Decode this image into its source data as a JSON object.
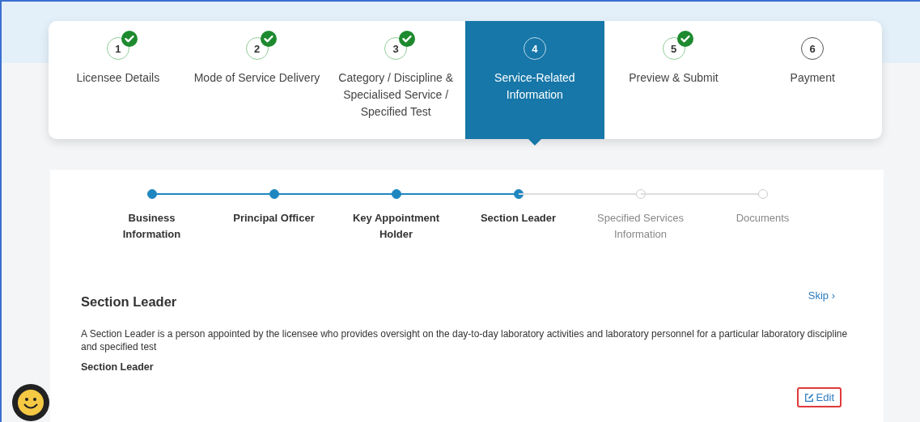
{
  "steps": [
    {
      "number": "1",
      "label": "Licensee Details",
      "completed": true,
      "selected": false
    },
    {
      "number": "2",
      "label": "Mode of Service Delivery",
      "completed": true,
      "selected": false
    },
    {
      "number": "3",
      "label": "Category / Discipline & Specialised Service / Specified Test",
      "completed": true,
      "selected": false
    },
    {
      "number": "4",
      "label": "Service-Related Information",
      "completed": false,
      "selected": true
    },
    {
      "number": "5",
      "label": "Preview & Submit",
      "completed": true,
      "selected": false
    },
    {
      "number": "6",
      "label": "Payment",
      "completed": false,
      "selected": false
    }
  ],
  "substeps": [
    {
      "label": "Business Information",
      "done": true
    },
    {
      "label": "Principal Officer",
      "done": true
    },
    {
      "label": "Key Appointment Holder",
      "done": true
    },
    {
      "label": "Section Leader",
      "done": true
    },
    {
      "label": "Specified Services Information",
      "done": false
    },
    {
      "label": "Documents",
      "done": false
    }
  ],
  "section": {
    "title": "Section Leader",
    "skip": "Skip ›",
    "description": "A Section Leader is a person appointed by the licensee who provides oversight on the day-to-day laboratory activities and laboratory personnel for a particular laboratory discipline and specified test",
    "subheading": "Section Leader",
    "edit": {
      "label": "Edit",
      "highlighted": true
    }
  }
}
